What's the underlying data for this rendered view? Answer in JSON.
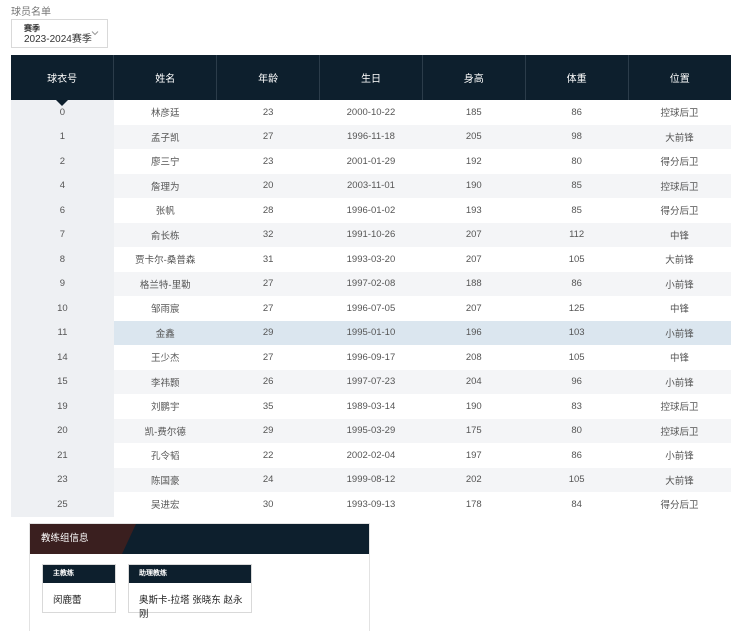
{
  "page": {
    "title": "球员名单"
  },
  "season_select": {
    "label": "赛季",
    "value": "2023-2024赛季"
  },
  "roster": {
    "columns": [
      "球衣号",
      "姓名",
      "年龄",
      "生日",
      "身高",
      "体重",
      "位置"
    ],
    "highlighted_row": 9,
    "rows": [
      [
        "0",
        "林彦廷",
        "23",
        "2000-10-22",
        "185",
        "86",
        "控球后卫"
      ],
      [
        "1",
        "孟子凯",
        "27",
        "1996-11-18",
        "205",
        "98",
        "大前锋"
      ],
      [
        "2",
        "廖三宁",
        "23",
        "2001-01-29",
        "192",
        "80",
        "得分后卫"
      ],
      [
        "4",
        "詹理为",
        "20",
        "2003-11-01",
        "190",
        "85",
        "控球后卫"
      ],
      [
        "6",
        "张帆",
        "28",
        "1996-01-02",
        "193",
        "85",
        "得分后卫"
      ],
      [
        "7",
        "俞长栋",
        "32",
        "1991-10-26",
        "207",
        "112",
        "中锋"
      ],
      [
        "8",
        "贾卡尔-桑普森",
        "31",
        "1993-03-20",
        "207",
        "105",
        "大前锋"
      ],
      [
        "9",
        "格兰特-里勒",
        "27",
        "1997-02-08",
        "188",
        "86",
        "小前锋"
      ],
      [
        "10",
        "邹雨宸",
        "27",
        "1996-07-05",
        "207",
        "125",
        "中锋"
      ],
      [
        "11",
        "金鑫",
        "29",
        "1995-01-10",
        "196",
        "103",
        "小前锋"
      ],
      [
        "14",
        "王少杰",
        "27",
        "1996-09-17",
        "208",
        "105",
        "中锋"
      ],
      [
        "15",
        "李祎颢",
        "26",
        "1997-07-23",
        "204",
        "96",
        "小前锋"
      ],
      [
        "19",
        "刘鹏宇",
        "35",
        "1989-03-14",
        "190",
        "83",
        "控球后卫"
      ],
      [
        "20",
        "凯-费尔德",
        "29",
        "1995-03-29",
        "175",
        "80",
        "控球后卫"
      ],
      [
        "21",
        "孔令韬",
        "22",
        "2002-02-04",
        "197",
        "86",
        "小前锋"
      ],
      [
        "23",
        "陈国豪",
        "24",
        "1999-08-12",
        "202",
        "105",
        "大前锋"
      ],
      [
        "25",
        "吴进宏",
        "30",
        "1993-09-13",
        "178",
        "84",
        "得分后卫"
      ]
    ]
  },
  "coaches": {
    "tab_label": "教练组信息",
    "head_coach_label": "主教练",
    "head_coach_name": "闵鹿蕾",
    "assistant_label": "助理教练",
    "assistant_names": "奥斯卡-拉塔 张晓东 赵永刚"
  },
  "colors": {
    "header_bg": "#0d1f2d",
    "tab_accent": "#3a1f1f",
    "highlight_row": "#dbe6ef"
  },
  "icons": {
    "select_arrow": "chevron-down-icon"
  }
}
